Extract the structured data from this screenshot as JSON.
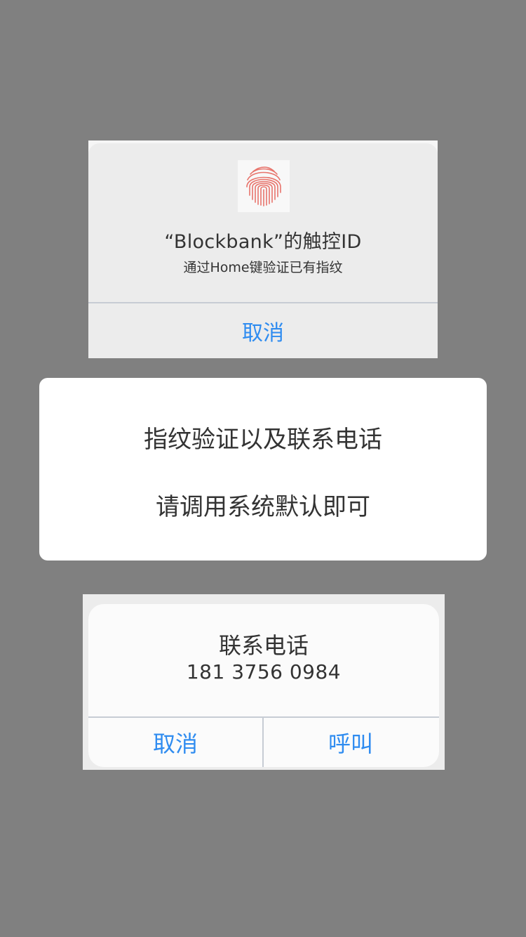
{
  "touch_id_alert": {
    "icon": "fingerprint-icon",
    "title": "“Blockbank”的触控ID",
    "subtitle": "通过Home键验证已有指纹",
    "cancel_label": "取消",
    "accent_color": "#2f8cf0",
    "icon_color": "#e8746c"
  },
  "info_card": {
    "line1": "指纹验证以及联系电话",
    "line2": "请调用系统默认即可"
  },
  "phone_alert": {
    "title": "联系电话",
    "number": "181 3756 0984",
    "cancel_label": "取消",
    "call_label": "呼叫"
  }
}
